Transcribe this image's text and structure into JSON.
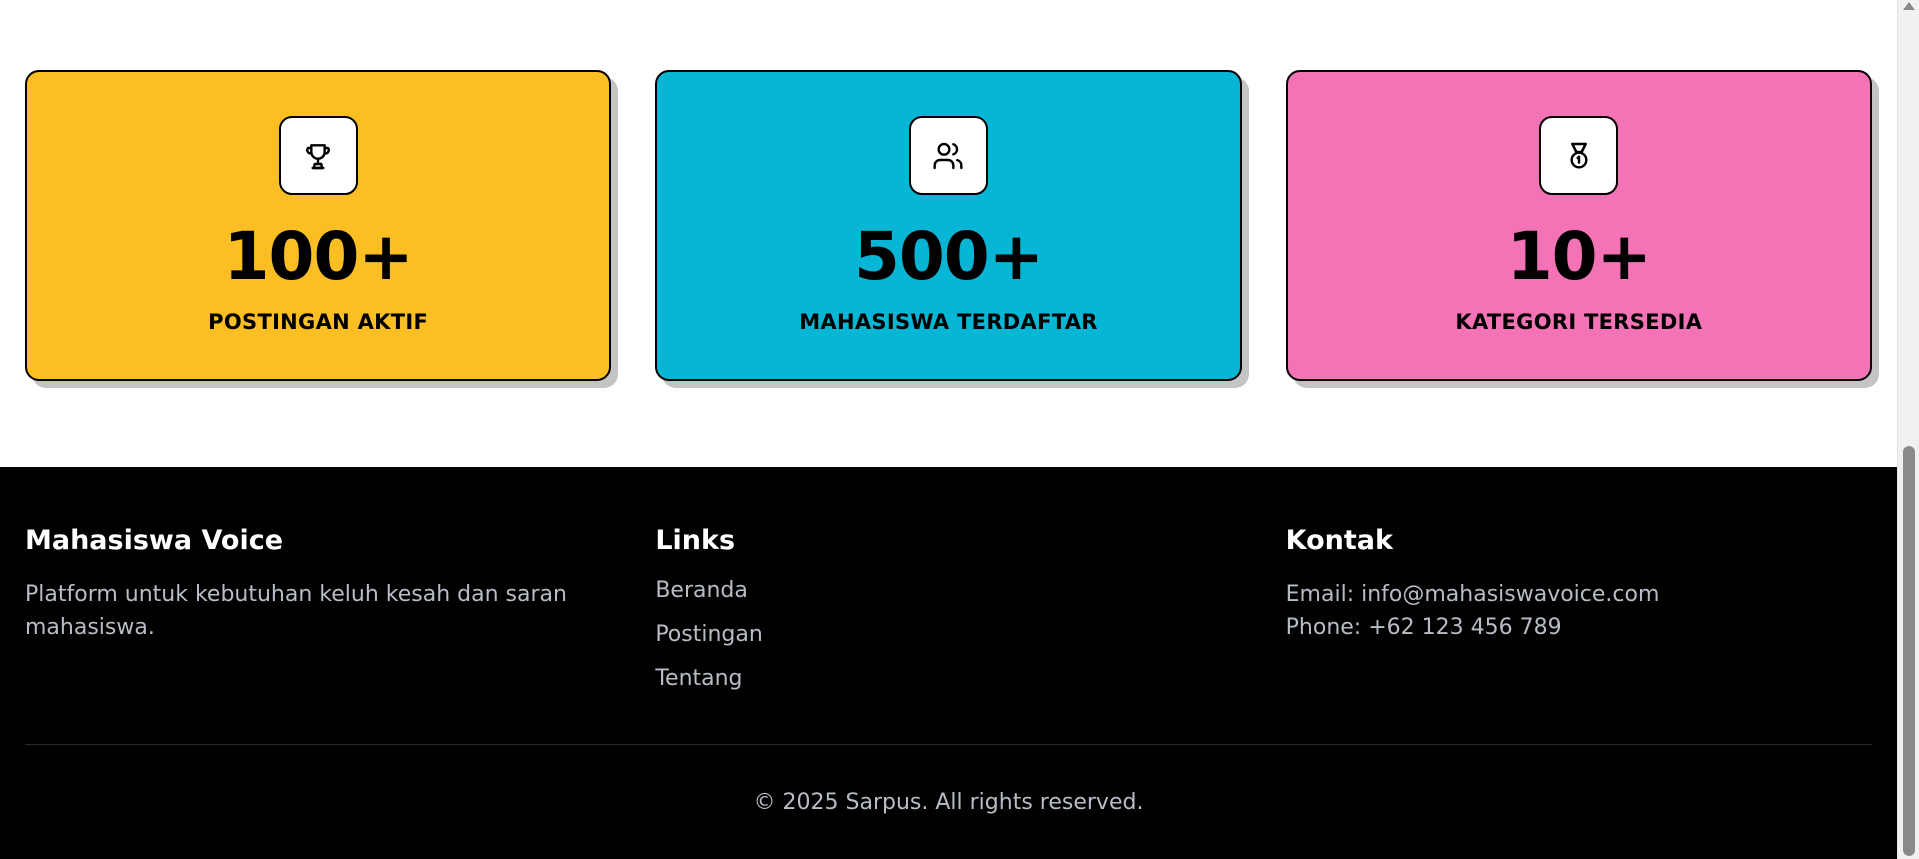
{
  "stats": [
    {
      "value": "100+",
      "label": "POSTINGAN AKTIF",
      "icon": "trophy-icon",
      "color": "#FBBF24"
    },
    {
      "value": "500+",
      "label": "MAHASISWA TERDAFTAR",
      "icon": "users-icon",
      "color": "#06B6D4"
    },
    {
      "value": "10+",
      "label": "KATEGORI TERSEDIA",
      "icon": "medal-icon",
      "color": "#F472B6"
    }
  ],
  "footer": {
    "about": {
      "title": "Mahasiswa Voice",
      "description": "Platform untuk kebutuhan keluh kesah dan saran mahasiswa."
    },
    "links": {
      "title": "Links",
      "items": [
        "Beranda",
        "Postingan",
        "Tentang"
      ]
    },
    "contact": {
      "title": "Kontak",
      "email": "Email: info@mahasiswavoice.com",
      "phone": "Phone: +62 123 456 789"
    },
    "copyright": "© 2025 Sarpus. All rights reserved."
  }
}
